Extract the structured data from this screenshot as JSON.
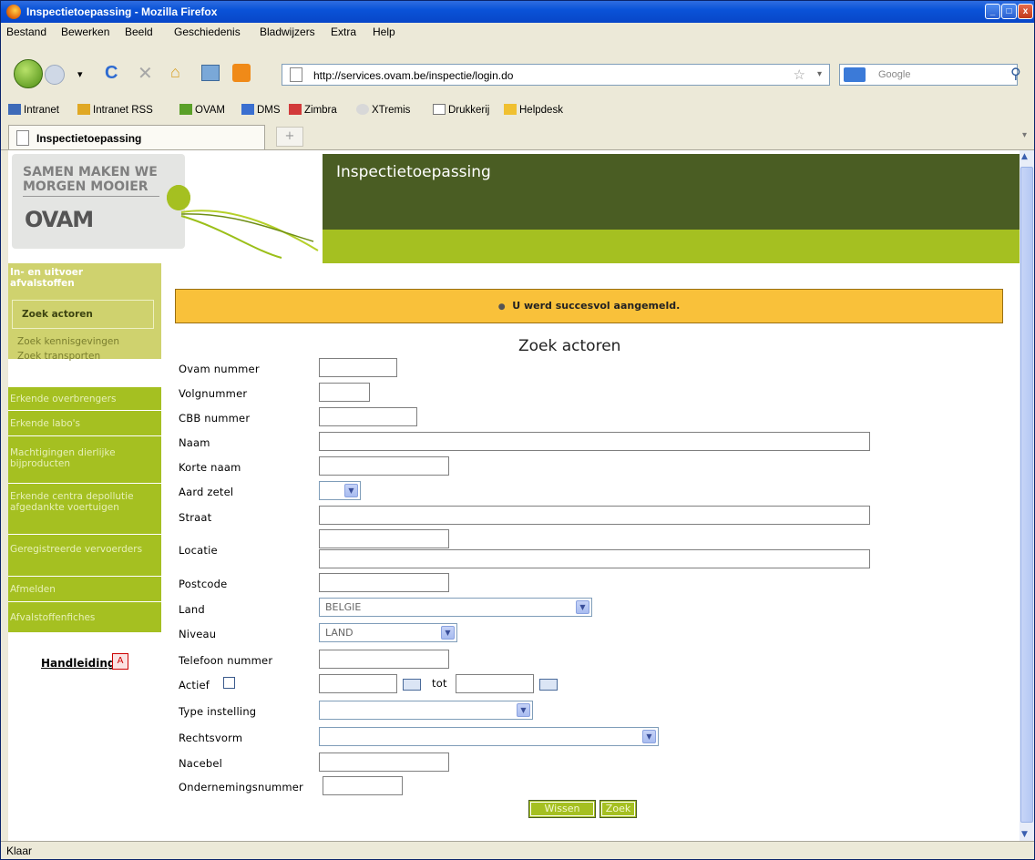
{
  "window": {
    "title": "Inspectietoepassing - Mozilla Firefox"
  },
  "menu": [
    "Bestand",
    "Bewerken",
    "Beeld",
    "Geschiedenis",
    "Bladwijzers",
    "Extra",
    "Help"
  ],
  "nav": {
    "url": "http://services.ovam.be/inspectie/login.do",
    "search_placeholder": "Google"
  },
  "bookmarks": [
    "Intranet",
    "Intranet RSS",
    "OVAM",
    "DMS",
    "Zimbra",
    "XTremis",
    "Drukkerij",
    "Helpdesk"
  ],
  "tab": {
    "label": "Inspectietoepassing",
    "newtab": "+"
  },
  "status": "Klaar",
  "page": {
    "logo_text": [
      "SAMEN MAKEN WE",
      "MORGEN MOOIER"
    ],
    "logo_brand": "OVAM",
    "header_title": "Inspectietoepassing",
    "message": "U werd succesvol aangemeld.",
    "title": "Zoek actoren",
    "handleiding": "Handleiding"
  },
  "sidenav": {
    "section1": "In- en uitvoer afvalstoffen",
    "active_item": "Zoek actoren",
    "sub_items": [
      "Zoek kennisgevingen",
      "Zoek transporten"
    ],
    "sections": [
      "Erkende overbrengers",
      "Erkende labo's",
      "Machtigingen dierlijke bijproducten",
      "Erkende centra depollutie afgedankte voertuigen",
      "Geregistreerde vervoerders",
      "Afmelden",
      "Afvalstoffenfiches"
    ]
  },
  "form": {
    "labels": {
      "ovam": "Ovam nummer",
      "volg": "Volgnummer",
      "cbb": "CBB nummer",
      "naam": "Naam",
      "korte": "Korte naam",
      "aard": "Aard zetel",
      "straat": "Straat",
      "locatie": "Locatie",
      "postcode": "Postcode",
      "land": "Land",
      "niveau": "Niveau",
      "telefoon": "Telefoon nummer",
      "actief": "Actief",
      "tot": "tot",
      "type": "Type instelling",
      "rechtsvorm": "Rechtsvorm",
      "nacebel": "Nacebel",
      "onderneming": "Ondernemingsnummer"
    },
    "land_value": "BELGIE",
    "niveau_value": "LAND",
    "buttons": {
      "wissen": "Wissen",
      "zoek": "Zoek"
    }
  }
}
